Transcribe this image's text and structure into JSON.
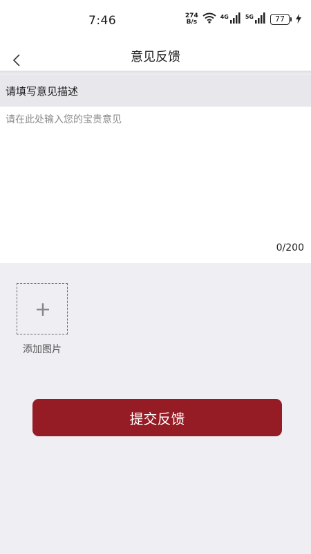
{
  "status_bar": {
    "time": "7:46",
    "net_speed_value": "274",
    "net_speed_unit": "B/s",
    "signal1_label": "4G",
    "signal2_label": "5G",
    "battery_level": "77"
  },
  "nav": {
    "title": "意见反馈"
  },
  "form": {
    "section_label": "请填写意见描述",
    "placeholder": "请在此处输入您的宝贵意见",
    "value": "",
    "counter": "0/200",
    "add_image_label": "添加图片"
  },
  "submit": {
    "label": "提交反馈"
  },
  "colors": {
    "accent": "#951b24",
    "page_background": "#efeef3"
  }
}
